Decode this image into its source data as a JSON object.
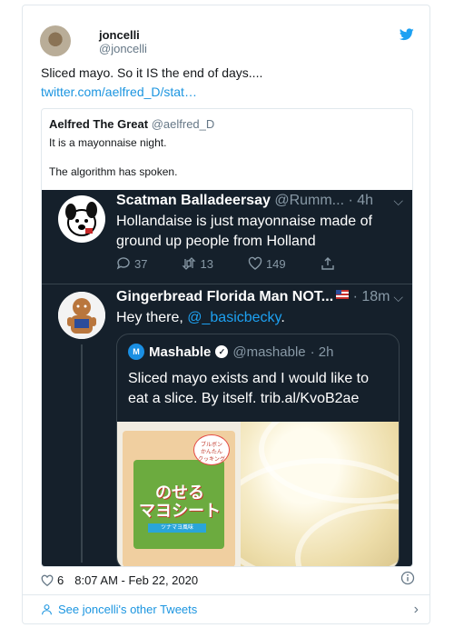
{
  "tweet": {
    "author_name": "joncelli",
    "author_handle": "@joncelli",
    "text": "Sliced mayo. So it IS the end of days....",
    "link": "twitter.com/aelfred_D/stat…",
    "likes": "6",
    "timestamp": "8:07 AM - Feb 22, 2020"
  },
  "quote": {
    "author_name": "Aelfred The Great",
    "author_handle": "@aelfred_D",
    "line1": "It is a mayonnaise night.",
    "line2": "The algorithm has spoken."
  },
  "screenshot": {
    "reply1": {
      "name": "Scatman Balladeersay",
      "handle": "@Rumm...",
      "time": "· 4h",
      "text": "Hollandaise is just mayonnaise made of ground up people from Holland",
      "replies": "37",
      "retweets": "13",
      "likes": "149"
    },
    "reply2": {
      "name": "Gingerbread Florida Man NOT...",
      "time": "· 18m",
      "text_prefix": "Hey there, ",
      "mention": "@_basicbecky",
      "text_suffix": "."
    },
    "inner_quote": {
      "logo_letter": "M",
      "name": "Mashable",
      "verified_mark": "✓",
      "handle": "@mashable",
      "time": "· 2h",
      "text": "Sliced mayo exists and I would like to eat a slice. By itself. trib.al/KvoB2ae"
    }
  },
  "footer": {
    "more_tweets": "See joncelli's other Tweets"
  },
  "colors": {
    "link": "#1b95e0",
    "twitter_blue": "#1da1f2",
    "dark_bg": "#15202b"
  }
}
